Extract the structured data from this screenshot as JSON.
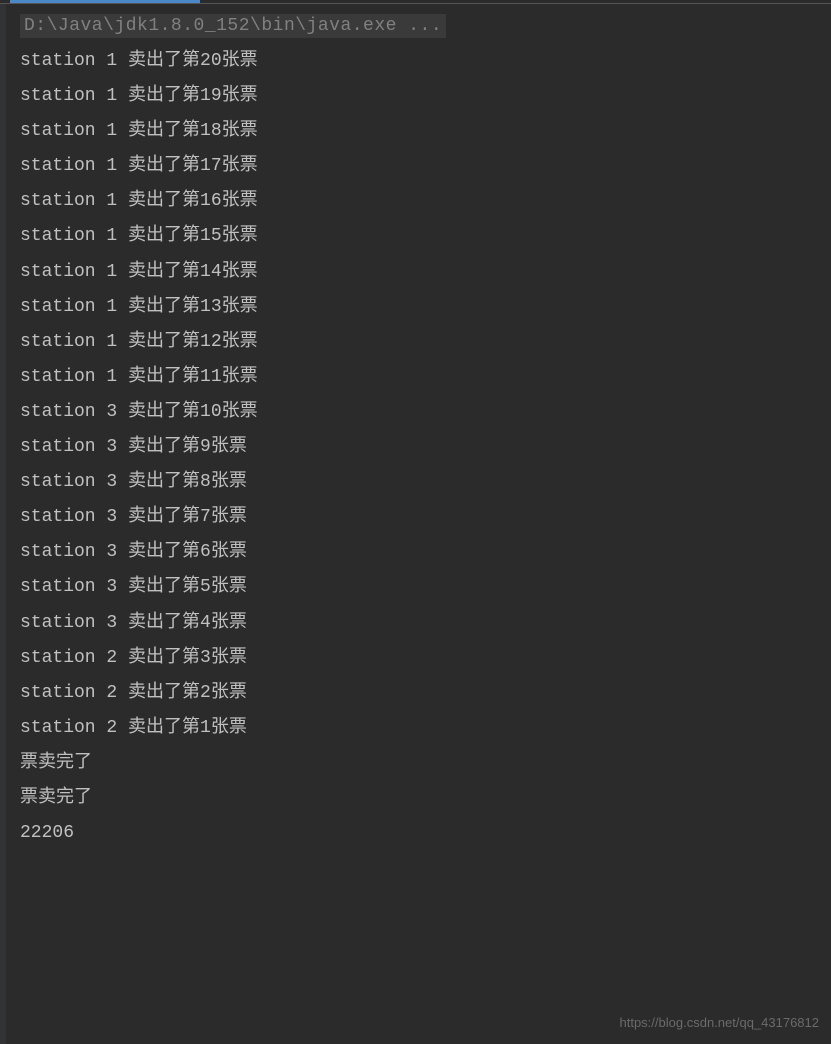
{
  "exec_path": "D:\\Java\\jdk1.8.0_152\\bin\\java.exe ...",
  "console_lines": [
    "station 1 卖出了第20张票",
    "station 1 卖出了第19张票",
    "station 1 卖出了第18张票",
    "station 1 卖出了第17张票",
    "station 1 卖出了第16张票",
    "station 1 卖出了第15张票",
    "station 1 卖出了第14张票",
    "station 1 卖出了第13张票",
    "station 1 卖出了第12张票",
    "station 1 卖出了第11张票",
    "station 3 卖出了第10张票",
    "station 3 卖出了第9张票",
    "station 3 卖出了第8张票",
    "station 3 卖出了第7张票",
    "station 3 卖出了第6张票",
    "station 3 卖出了第5张票",
    "station 3 卖出了第4张票",
    "station 2 卖出了第3张票",
    "station 2 卖出了第2张票",
    "station 2 卖出了第1张票",
    "票卖完了",
    "票卖完了",
    "22206"
  ],
  "watermark": "https://blog.csdn.net/qq_43176812"
}
